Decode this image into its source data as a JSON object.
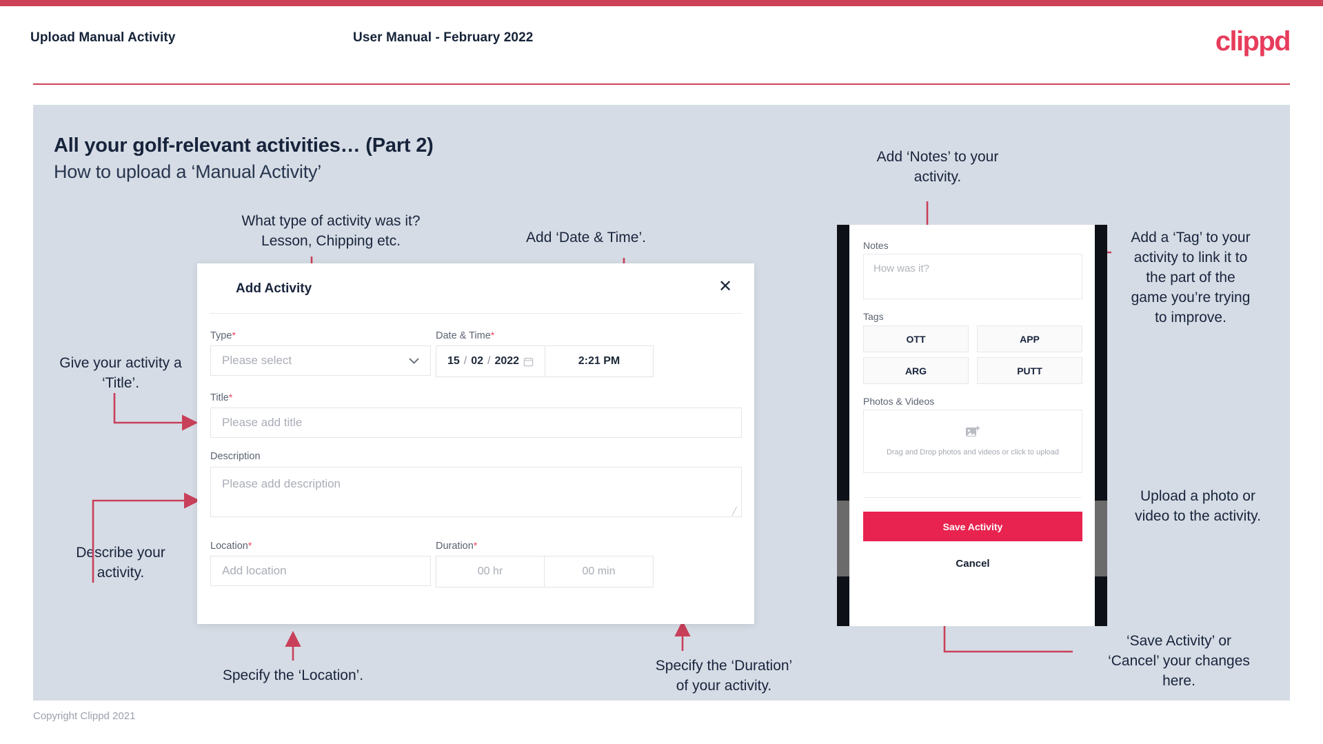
{
  "header": {
    "left_title": "Upload Manual Activity",
    "center_title": "User Manual - February 2022",
    "logo": "clippd"
  },
  "slide": {
    "title_line1": "All your golf-relevant activities… (Part 2)",
    "title_line2": "How to upload a ‘Manual Activity’"
  },
  "annotations": {
    "type": "What type of activity was it?\nLesson, Chipping etc.",
    "datetime": "Add ‘Date & Time’.",
    "title": "Give your activity a\n‘Title’.",
    "description": "Describe your\nactivity.",
    "location": "Specify the ‘Location’.",
    "duration": "Specify the ‘Duration’\nof your activity.",
    "notes": "Add ‘Notes’ to your\nactivity.",
    "tags": "Add a ‘Tag’ to your\nactivity to link it to\nthe part of the\ngame you’re trying\nto improve.",
    "upload": "Upload a photo or\nvideo to the activity.",
    "save_cancel": "‘Save Activity’ or\n‘Cancel’ your changes\nhere."
  },
  "dialog": {
    "title": "Add Activity",
    "close_icon": "close-icon",
    "type": {
      "label": "Type",
      "required": "*",
      "placeholder": "Please select",
      "caret": "chevron-down-icon"
    },
    "datetime": {
      "label": "Date & Time",
      "required": "*",
      "day": "15",
      "sep1": "/",
      "month": "02",
      "sep2": "/",
      "year": "2022",
      "calendar_icon": "calendar-icon",
      "time": "2:21 PM"
    },
    "title_field": {
      "label": "Title",
      "required": "*",
      "placeholder": "Please add title"
    },
    "description": {
      "label": "Description",
      "placeholder": "Please add description"
    },
    "location": {
      "label": "Location",
      "required": "*",
      "placeholder": "Add location"
    },
    "duration": {
      "label": "Duration",
      "required": "*",
      "hours": "00 hr",
      "minutes": "00 min"
    }
  },
  "phone": {
    "notes": {
      "label": "Notes",
      "placeholder": "How was it?"
    },
    "tags": {
      "label": "Tags",
      "items": [
        "OTT",
        "APP",
        "ARG",
        "PUTT"
      ]
    },
    "photos": {
      "label": "Photos & Videos",
      "icon": "image-add-icon",
      "drop_text": "Drag and Drop photos and videos or\nclick to upload"
    },
    "save_label": "Save Activity",
    "cancel_label": "Cancel"
  },
  "footer": {
    "copyright": "Copyright Clippd 2021"
  },
  "colors": {
    "accent": "#ce4257",
    "save_button": "#e8234f",
    "slide_bg": "#d6dce5",
    "text_dark": "#16233b"
  }
}
